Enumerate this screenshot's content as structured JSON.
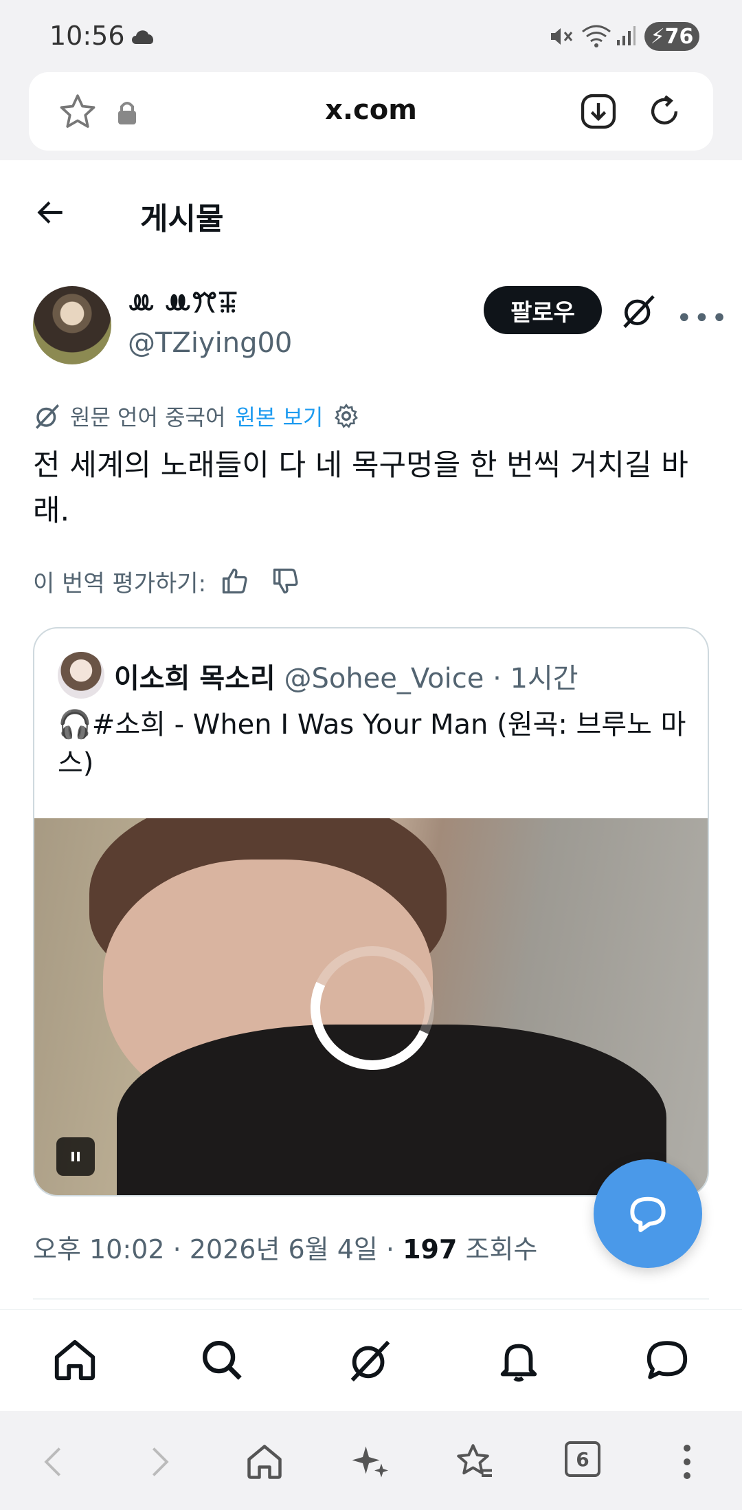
{
  "status_bar": {
    "time": "10:56",
    "battery": "76"
  },
  "browser": {
    "url": "x.com",
    "tab_count": "6"
  },
  "header": {
    "title": "게시물"
  },
  "post": {
    "display_name": "ꔛ ꔚꔫꔯ",
    "handle": "@TZiying00",
    "follow_label": "팔로우",
    "translation_notice": "원문 언어 중국어",
    "show_original": "원본 보기",
    "text": "전 세계의 노래들이 다 네 목구멍을 한 번씩 거치길 바래.",
    "rate_translation": "이 번역 평가하기:",
    "timestamp": "오후 10:02 · 2026년 6월 4일 · ",
    "views_count": "197",
    "views_label": "조회수"
  },
  "quote": {
    "name": "이소희 목소리",
    "handle": "@Sohee_Voice",
    "separator": "·",
    "time": "1시간",
    "text": "🎧#소희 - When I Was Your Man (원곡: 브루노 마스)"
  },
  "colors": {
    "accent": "#1d9bf0",
    "fab": "#4a99e9",
    "text_primary": "#0f1419",
    "text_secondary": "#536471"
  },
  "icons": {
    "x_nav": [
      "home-icon",
      "search-icon",
      "grok-icon",
      "notifications-icon",
      "messages-icon"
    ],
    "browser_nav": [
      "back-icon",
      "forward-icon",
      "home-icon",
      "sparkle-icon",
      "bookmarks-icon",
      "tabs-icon",
      "menu-icon"
    ]
  }
}
